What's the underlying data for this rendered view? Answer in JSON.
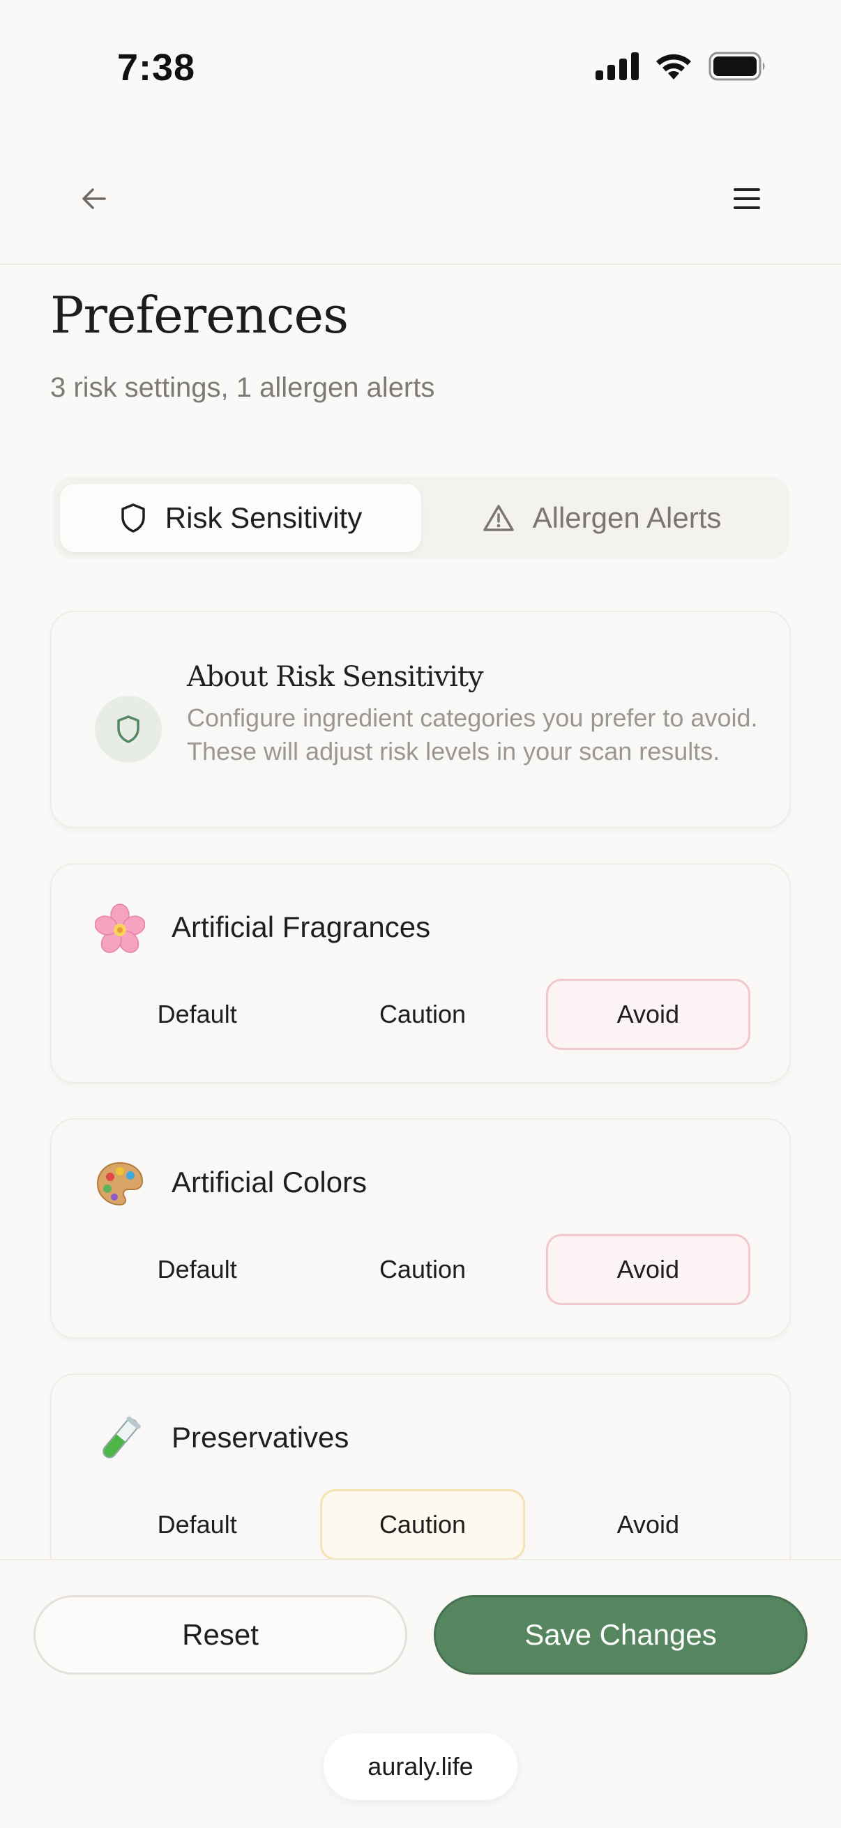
{
  "status_bar": {
    "time": "7:38"
  },
  "header": {
    "title": "Preferences",
    "subtitle": "3 risk settings, 1 allergen alerts"
  },
  "tabs": [
    {
      "label": "Risk Sensitivity",
      "icon": "shield-icon",
      "active": true
    },
    {
      "label": "Allergen Alerts",
      "icon": "warning-triangle-icon",
      "active": false
    }
  ],
  "info_card": {
    "title": "About Risk Sensitivity",
    "body": "Configure ingredient categories you prefer to avoid. These will adjust risk levels in your scan results."
  },
  "settings": [
    {
      "name": "Artificial Fragrances",
      "icon": "cherry-blossom-icon",
      "options": [
        "Default",
        "Caution",
        "Avoid"
      ],
      "selected": "Avoid"
    },
    {
      "name": "Artificial Colors",
      "icon": "artist-palette-icon",
      "options": [
        "Default",
        "Caution",
        "Avoid"
      ],
      "selected": "Avoid"
    },
    {
      "name": "Preservatives",
      "icon": "test-tube-icon",
      "options": [
        "Default",
        "Caution",
        "Avoid"
      ],
      "selected": "Caution"
    }
  ],
  "footer": {
    "reset_label": "Reset",
    "save_label": "Save Changes",
    "url": "auraly.life"
  },
  "colors": {
    "primary": "#558660",
    "avoid_border": "#f2c6cd",
    "caution_border": "#f4e2b3",
    "background": "#faf9f7"
  }
}
